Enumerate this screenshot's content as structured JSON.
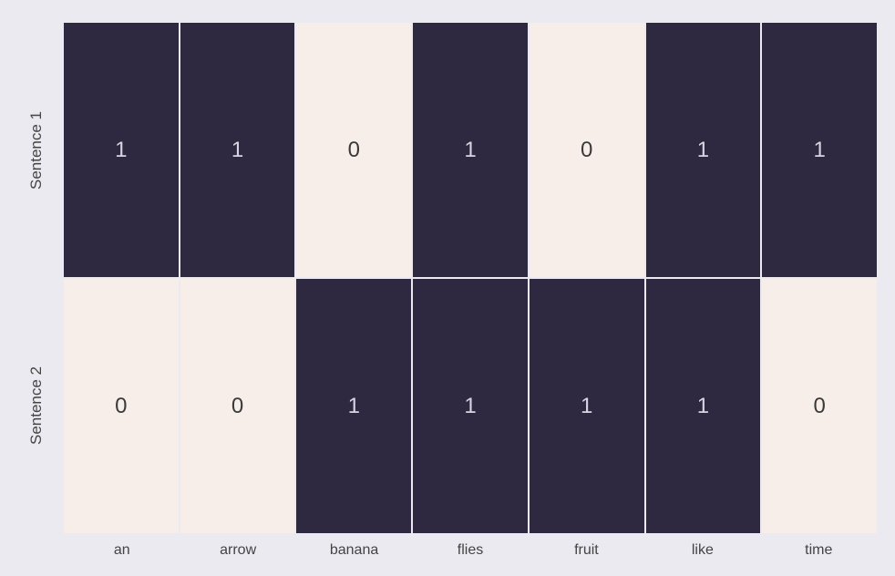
{
  "chart_data": {
    "type": "heatmap",
    "rows": [
      "Sentence 1",
      "Sentence 2"
    ],
    "columns": [
      "an",
      "arrow",
      "banana",
      "flies",
      "fruit",
      "like",
      "time"
    ],
    "values": [
      [
        1,
        1,
        0,
        1,
        0,
        1,
        1
      ],
      [
        0,
        0,
        1,
        1,
        1,
        1,
        0
      ]
    ],
    "color_low": "#f7eee9",
    "color_high": "#2e2841"
  }
}
